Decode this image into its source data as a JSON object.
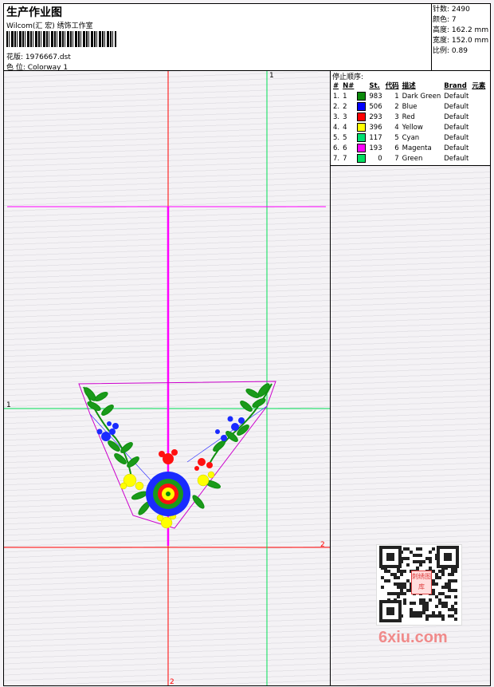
{
  "header": {
    "title": "生产作业图",
    "company": "Wilcom(汇 宏) 绣饰工作室",
    "design_label": "花版:",
    "design_file": "1976667.dst",
    "color_label": "色 位:",
    "colorway": "Colorway 1"
  },
  "stats": {
    "stitches_label": "针数:",
    "stitches": "2490",
    "colors_label": "颜色:",
    "colors": "7",
    "height_label": "高度:",
    "height": "162.2 mm",
    "width_label": "宽度:",
    "width": "152.0 mm",
    "scale_label": "比例:",
    "scale": "0.89"
  },
  "sequence": {
    "title": "停止顺序:",
    "headers": [
      "#",
      "N#",
      "St.",
      "代码",
      "描述",
      "Brand",
      "元素"
    ],
    "rows": [
      {
        "idx": "1.",
        "n": "1",
        "st": "983",
        "code": "1",
        "desc": "Dark Green",
        "brand": "Default",
        "color": "#0b8a0b"
      },
      {
        "idx": "2.",
        "n": "2",
        "st": "506",
        "code": "2",
        "desc": "Blue",
        "brand": "Default",
        "color": "#0000ff"
      },
      {
        "idx": "3.",
        "n": "3",
        "st": "293",
        "code": "3",
        "desc": "Red",
        "brand": "Default",
        "color": "#ff0000"
      },
      {
        "idx": "4.",
        "n": "4",
        "st": "396",
        "code": "4",
        "desc": "Yellow",
        "brand": "Default",
        "color": "#ffff00"
      },
      {
        "idx": "5.",
        "n": "5",
        "st": "117",
        "code": "5",
        "desc": "Cyan",
        "brand": "Default",
        "color": "#00e070"
      },
      {
        "idx": "6.",
        "n": "6",
        "st": "193",
        "code": "6",
        "desc": "Magenta",
        "brand": "Default",
        "color": "#ff00ff"
      },
      {
        "idx": "7.",
        "n": "7",
        "st": "0",
        "code": "7",
        "desc": "Green",
        "brand": "Default",
        "color": "#00e060"
      }
    ]
  },
  "canvas": {
    "guide_label_1_top": "1",
    "guide_label_1_left": "1",
    "guide_label_2_right": "2",
    "guide_label_2_bottom": "2"
  },
  "watermark": {
    "text": "6xiu.com",
    "badge": "刺绣图库"
  },
  "colors": {
    "magenta_guide": "#ff00ff",
    "red_guide": "#ff0000",
    "green_guide": "#00cc44"
  }
}
